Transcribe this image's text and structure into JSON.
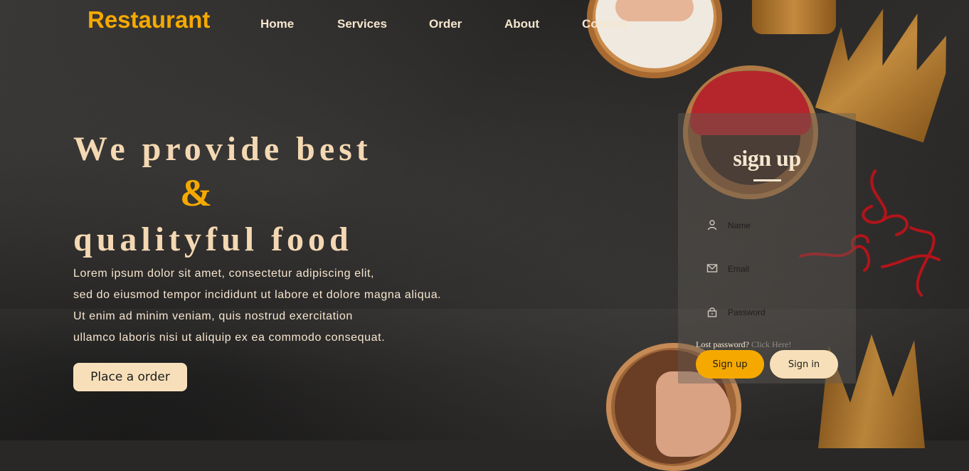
{
  "brand": "Restaurant",
  "nav": {
    "items": [
      "Home",
      "Services",
      "Order",
      "About",
      "Contact"
    ]
  },
  "hero": {
    "title_line1": "We provide best",
    "ampersand": "&",
    "title_line2": "qualityful food",
    "lines": [
      "Lorem ipsum dolor sit amet, consectetur adipiscing elit,",
      "sed do eiusmod tempor incididunt ut labore et dolore magna aliqua.",
      "Ut enim ad minim veniam, quis nostrud exercitation",
      "ullamco laboris nisi ut aliquip ex ea commodo consequat."
    ],
    "cta_label": "Place a order"
  },
  "signup": {
    "title": "sign up",
    "name_placeholder": "Name",
    "email_placeholder": "Email",
    "password_placeholder": "Password",
    "lost_text": "Lost password?",
    "click_here": "Click Here!",
    "signup_label": "Sign up",
    "signin_label": "Sign in"
  },
  "colors": {
    "accent": "#f5a900",
    "cream": "#f7e0b9",
    "text_light": "#f5e6cf"
  }
}
